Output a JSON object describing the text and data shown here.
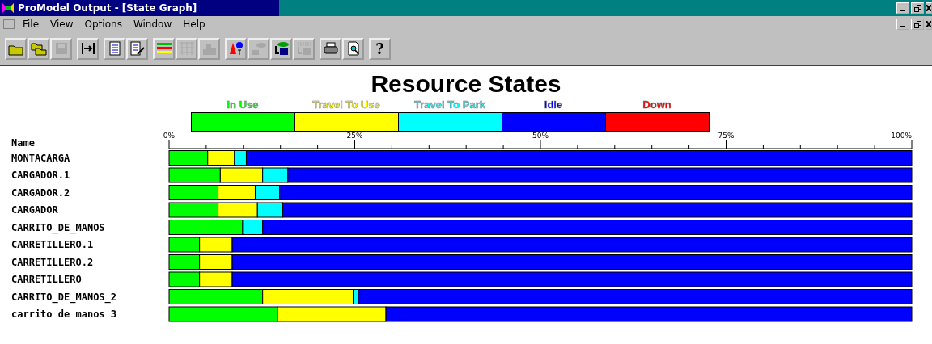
{
  "window": {
    "title": "ProModel Output - [State Graph]"
  },
  "menu": [
    "File",
    "View",
    "Options",
    "Window",
    "Help"
  ],
  "toolbar_groups": [
    [
      {
        "kind": "open",
        "disabled": false
      },
      {
        "kind": "open-multi",
        "disabled": false
      },
      {
        "kind": "save",
        "disabled": true
      }
    ],
    [
      {
        "kind": "compare",
        "disabled": false
      }
    ],
    [
      {
        "kind": "document",
        "disabled": false
      },
      {
        "kind": "document-edit",
        "disabled": false
      }
    ],
    [
      {
        "kind": "state-bars",
        "disabled": false
      },
      {
        "kind": "grid",
        "disabled": true
      },
      {
        "kind": "histogram",
        "disabled": true
      }
    ],
    [
      {
        "kind": "shapes",
        "disabled": false
      },
      {
        "kind": "cloud",
        "disabled": true
      },
      {
        "kind": "export",
        "disabled": false
      },
      {
        "kind": "binary",
        "disabled": true
      }
    ],
    [
      {
        "kind": "print",
        "disabled": false
      },
      {
        "kind": "preview",
        "disabled": false
      }
    ],
    [
      {
        "kind": "help",
        "disabled": false,
        "label": "?"
      }
    ]
  ],
  "chart": {
    "name_header": "Name",
    "chart_data": {
      "type": "bar",
      "orientation": "horizontal",
      "stacked": true,
      "title": "Resource States",
      "categories": [
        "MONTACARGA",
        "CARGADOR.1",
        "CARGADOR.2",
        "CARGADOR",
        "CARRITO_DE_MANOS",
        "CARRETILLERO.1",
        "CARRETILLERO.2",
        "CARRETILLERO",
        "CARRITO_DE_MANOS_2",
        "carrito de manos 3"
      ],
      "xlim": [
        0,
        100
      ],
      "xticks": [
        {
          "value": 0,
          "label": "0%"
        },
        {
          "value": 25,
          "label": "25%"
        },
        {
          "value": 50,
          "label": "50%"
        },
        {
          "value": 75,
          "label": "75%"
        },
        {
          "value": 100,
          "label": "100%"
        }
      ],
      "series": [
        {
          "name": "In Use",
          "color": "#00ff00",
          "values": [
            5.2,
            6.9,
            6.6,
            6.6,
            9.9,
            4.1,
            4.1,
            4.1,
            12.6,
            14.6
          ]
        },
        {
          "name": "Travel To Use",
          "color": "#ffff00",
          "values": [
            3.6,
            5.7,
            5.0,
            5.3,
            0,
            4.4,
            4.4,
            4.4,
            12.2,
            14.6
          ]
        },
        {
          "name": "Travel To Park",
          "color": "#00ffff",
          "values": [
            1.6,
            3.4,
            3.3,
            3.4,
            2.7,
            0,
            0,
            0,
            0.7,
            0
          ]
        },
        {
          "name": "Idle",
          "color": "#0000ff",
          "values": [
            89.6,
            84.0,
            85.1,
            84.7,
            87.4,
            91.5,
            91.5,
            91.5,
            74.5,
            70.8
          ]
        },
        {
          "name": "Down",
          "color": "#ff0000",
          "values": [
            0,
            0,
            0,
            0,
            0,
            0,
            0,
            0,
            0,
            0
          ]
        }
      ]
    }
  }
}
